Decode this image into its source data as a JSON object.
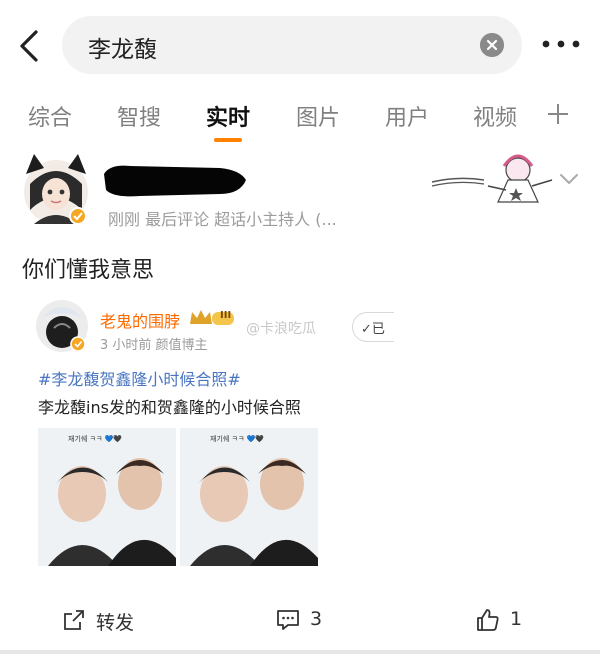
{
  "search": {
    "query": "李龙馥"
  },
  "tabs": [
    {
      "label": "综合"
    },
    {
      "label": "智搜"
    },
    {
      "label": "实时"
    },
    {
      "label": "图片"
    },
    {
      "label": "用户"
    },
    {
      "label": "视频"
    }
  ],
  "active_tab": "实时",
  "post": {
    "meta": "刚刚  最后评论  超话小主持人 (...",
    "text": "你们懂我意思",
    "repost": {
      "author": "老鬼的围脖",
      "level_badge": "III",
      "meta": "3 小时前  颜值博主",
      "watermark": "@卡浪吃瓜",
      "follow_label": "✓已",
      "topic": "#李龙馥贺鑫隆小时候合照#",
      "text": "李龙馥ins发的和贺鑫隆的小时候合照",
      "photo_caption": "재기쉐 ㅋㅋ 💙🖤"
    }
  },
  "actions": {
    "repost_label": "转发",
    "comments_count": "3",
    "likes_count": "1"
  },
  "colors": {
    "accent": "#ff8200",
    "topic": "#4a76c2",
    "author": "#ff6a00"
  },
  "icons": [
    "back-icon",
    "clear-icon",
    "more-icon",
    "plus-icon",
    "verified-icon",
    "caret-down-icon",
    "share-icon",
    "comment-icon",
    "like-icon"
  ]
}
